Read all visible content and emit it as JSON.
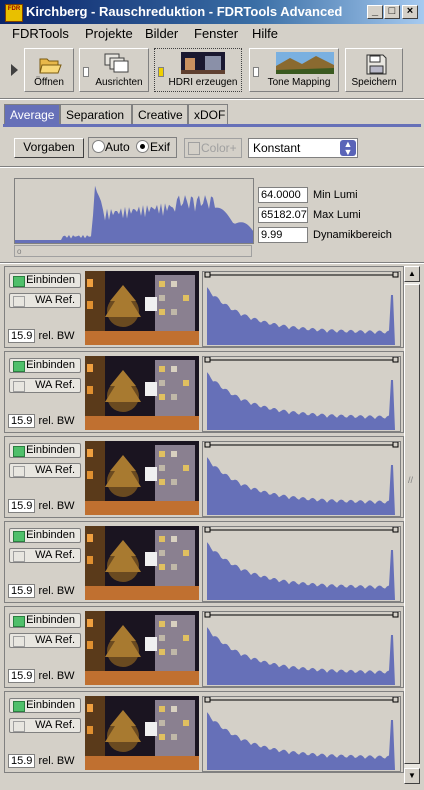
{
  "window": {
    "title": "Kirchberg - Rauschreduktion - FDRTools Advanced",
    "app_icon_label": "FDR Tools",
    "min": "_",
    "max": "□",
    "close": "×"
  },
  "menu": [
    "FDRTools",
    "Projekte",
    "Bilder",
    "Fenster",
    "Hilfe"
  ],
  "toolbar": {
    "open": "Öffnen",
    "align": "Ausrichten",
    "hdri": "HDRI erzeugen",
    "tonemap": "Tone Mapping",
    "save": "Speichern"
  },
  "tabs": [
    "Average",
    "Separation",
    "Creative",
    "xDOF"
  ],
  "active_tab": "Average",
  "controls": {
    "defaults_button": "Vorgaben",
    "auto_label": "Auto",
    "exif_label": "Exif",
    "exif_selected": true,
    "colorplus_label": "Color+",
    "mode_value": "Konstant"
  },
  "stats": {
    "min_lumi_value": "64.0000",
    "min_lumi_label": "Min Lumi",
    "max_lumi_value": "65182.07",
    "max_lumi_label": "Max Lumi",
    "dyn_value": "9.99",
    "dyn_label": "Dynamikbereich"
  },
  "image_rows": [
    {
      "include_label": "Einbinden",
      "wa_label": "WA Ref.",
      "bw_value": "15.9",
      "bw_label": "rel. BW"
    },
    {
      "include_label": "Einbinden",
      "wa_label": "WA Ref.",
      "bw_value": "15.9",
      "bw_label": "rel. BW"
    },
    {
      "include_label": "Einbinden",
      "wa_label": "WA Ref.",
      "bw_value": "15.9",
      "bw_label": "rel. BW"
    },
    {
      "include_label": "Einbinden",
      "wa_label": "WA Ref.",
      "bw_value": "15.9",
      "bw_label": "rel. BW"
    },
    {
      "include_label": "Einbinden",
      "wa_label": "WA Ref.",
      "bw_value": "15.9",
      "bw_label": "rel. BW"
    },
    {
      "include_label": "Einbinden",
      "wa_label": "WA Ref.",
      "bw_value": "15.9",
      "bw_label": "rel. BW"
    }
  ],
  "colors": {
    "title_gradient_start": "#0a246a",
    "accent": "#6670b8",
    "histogram_fill": "#6670b8",
    "include_on": "#4fbf6a"
  }
}
